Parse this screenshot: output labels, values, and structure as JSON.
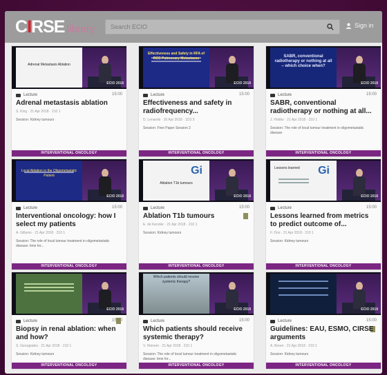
{
  "header": {
    "logo_c": "C",
    "logo_i": "I",
    "logo_rse": "RSE",
    "logo_library": "library",
    "search_placeholder": "Search ECIO",
    "signin": "Sign in"
  },
  "cards": [
    {
      "type": "Lecture",
      "duration": "15:00",
      "title": "Adrenal metastasis ablation",
      "sub": "S. King · 21 Apr 2018 · 210 1",
      "session": "Session: Kidney tumours",
      "category": "INTERVENTIONAL ONCOLOGY",
      "slide_text": "Adrenal Metastasis Ablation",
      "venue": "ECIO 2018"
    },
    {
      "type": "Lecture",
      "duration": "15:00",
      "title": "Effectiveness and safety in radiofrequency...",
      "sub": "D. Lenarski · 20 Apr 2018 · 1D3 5",
      "session": "Session: Free Paper Session 2",
      "category": "INTERVENTIONAL ONCOLOGY",
      "slide_text": "Effectiveness and Safety in RFA of RCC Pulmonary Metastases",
      "venue": "ECIO 2018"
    },
    {
      "type": "Lecture",
      "duration": "15:00",
      "title": "SABR, conventional radiotherapy or nothing at all...",
      "sub": "J. Hobbs · 21 Apr 2018 · 210 1",
      "session": "Session: The role of local tumour treatment in oligometastatic disease",
      "category": "INTERVENTIONAL ONCOLOGY",
      "slide_text": "SABR, conventional radiotherapy or nothing at all – which choice when?",
      "venue": "ECIO 2018"
    },
    {
      "type": "Lecture",
      "duration": "15:00",
      "title": "Interventional oncology: how I select my patients",
      "sub": "A. Gillams · 21 Apr 2018 · 210 1",
      "session": "Session: The role of local tumour treatment in oligometastatic disease: time for...",
      "category": "INTERVENTIONAL ONCOLOGY",
      "slide_text": "Local Ablation in the Oligometastatic Patient",
      "venue": "ECIO 2018"
    },
    {
      "type": "Lecture",
      "duration": "15:00",
      "title": "Ablation T1b tumours",
      "sub": "E. de Kerviler · 21 Apr 2018 · 210 1",
      "session": "Session: Kidney tumours",
      "category": "INTERVENTIONAL ONCOLOGY",
      "slide_text": "Ablation T1b tumours",
      "venue": "ECIO 2018"
    },
    {
      "type": "Lecture",
      "duration": "15:00",
      "title": "Lessons learned from metrics to predict outcome of...",
      "sub": "F. Orsi · 21 Apr 2018 · 210 1",
      "session": "Session: Kidney tumours",
      "category": "INTERVENTIONAL ONCOLOGY",
      "slide_text": "Lessons learned",
      "venue": "ECIO 2018"
    },
    {
      "type": "Lecture",
      "duration": "15:00",
      "title": "Biopsy in renal ablation: when and how?",
      "sub": "S. Georgiades · 21 Apr 2018 · 210 1",
      "session": "Session: Kidney tumours",
      "category": "INTERVENTIONAL ONCOLOGY",
      "slide_text": "",
      "venue": "ECIO 2018"
    },
    {
      "type": "Lecture",
      "duration": "15:00",
      "title": "Which patients should receive systemic therapy?",
      "sub": "V. Heinem · 21 Apr 2018 · 210 1",
      "session": "Session: The role of local tumour treatment in oligometastatic disease: time for...",
      "category": "INTERVENTIONAL ONCOLOGY",
      "slide_text": "Which patients should receive systemic therapy?",
      "venue": "ECIO 2018"
    },
    {
      "type": "Lecture",
      "duration": "15:00",
      "title": "Guidelines: EAU, ESMO, CIRSE arguments",
      "sub": "A. Breen · 21 Apr 2018 · 210 1",
      "session": "Session: Kidney tumours",
      "category": "INTERVENTIONAL ONCOLOGY",
      "slide_text": "",
      "venue": "ECIO 2018"
    }
  ]
}
